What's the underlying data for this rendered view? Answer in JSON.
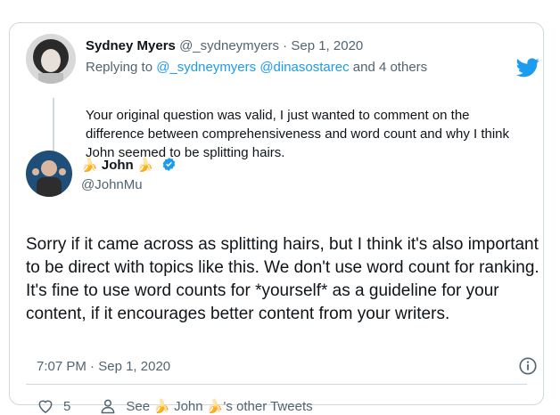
{
  "colors": {
    "accent": "#1d9bf0",
    "muted": "#536471",
    "text": "#0f1419",
    "border": "#cfd9de"
  },
  "reply": {
    "author_name": "Sydney Myers",
    "handle": "@_sydneymyers",
    "separator": "·",
    "date": "Sep 1, 2020",
    "replying_label": "Replying to",
    "replying_handles": "@_sydneymyers @dinasostarec",
    "replying_rest": "and 4 others",
    "text": "Your original question was valid, I just wanted to comment on the difference between comprehensiveness and word count and why I think John seemed to be splitting hairs."
  },
  "tweet": {
    "author_name": "John",
    "emoji_left": "🍌",
    "emoji_right": "🍌",
    "handle": "@JohnMu",
    "text": "Sorry if it came across as splitting hairs, but I think it's also important to be direct with topics like this. We don't use word count for ranking. It's fine to use word counts for *yourself* as a guideline for your content, if it encourages better content from your writers.",
    "time": "7:07 PM",
    "separator": "·",
    "date": "Sep 1, 2020"
  },
  "actions": {
    "like_count": "5",
    "see_label": "See",
    "other_name": "John",
    "emoji": "🍌",
    "other_tweets_label": "'s other Tweets"
  },
  "icons": [
    "twitter-bird-icon",
    "verified-badge-icon",
    "info-icon",
    "heart-icon",
    "person-icon",
    "banana-emoji-icon"
  ]
}
